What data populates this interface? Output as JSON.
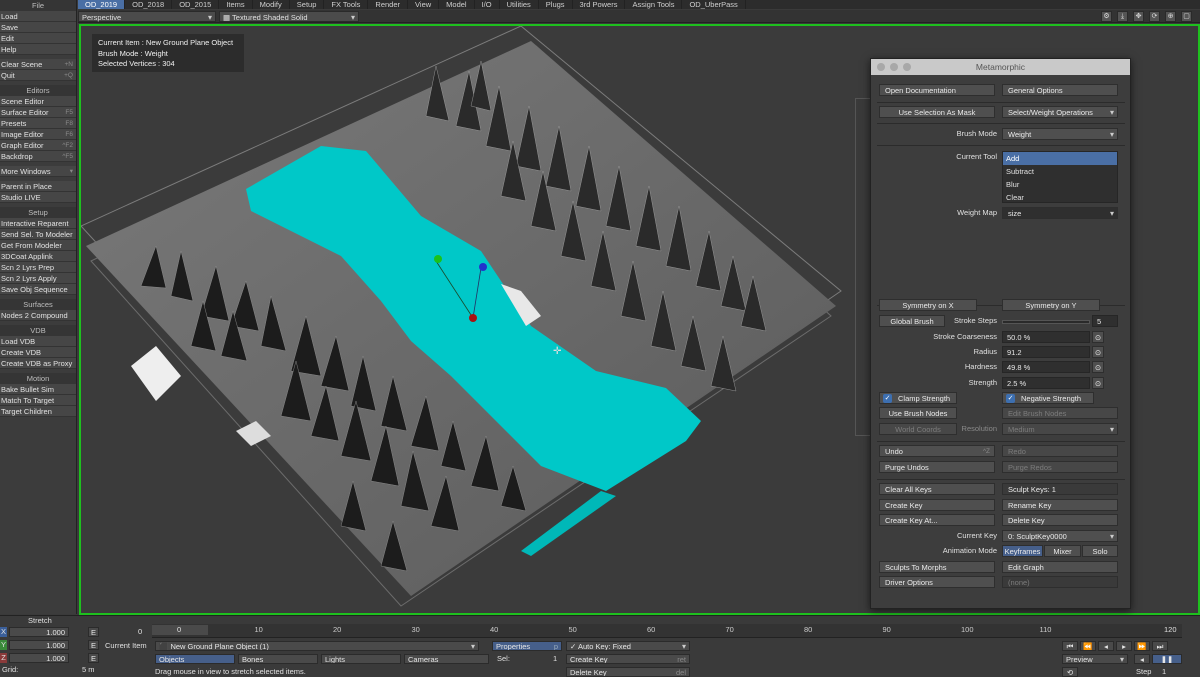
{
  "menubar": [
    "OD_2019",
    "OD_2018",
    "OD_2015",
    "Items",
    "Modify",
    "Setup",
    "FX Tools",
    "Render",
    "View",
    "Model",
    "I/O",
    "Utilities",
    "Plugs",
    "3rd Powers",
    "Assign Tools",
    "OD_UberPass"
  ],
  "sidebar": {
    "file_header": "File",
    "file_items": [
      {
        "label": "Load",
        "key": ""
      },
      {
        "label": "Save",
        "key": ""
      },
      {
        "label": "Edit",
        "key": ""
      },
      {
        "label": "Help",
        "key": ""
      }
    ],
    "clear_scene": {
      "label": "Clear Scene",
      "key": "+N"
    },
    "quit": {
      "label": "Quit",
      "key": "+Q"
    },
    "editors_header": "Editors",
    "editors": [
      {
        "label": "Scene Editor",
        "key": ""
      },
      {
        "label": "Surface Editor",
        "key": "F5"
      },
      {
        "label": "Presets",
        "key": "F8"
      },
      {
        "label": "Image Editor",
        "key": "F6"
      },
      {
        "label": "Graph Editor",
        "key": "^F2"
      },
      {
        "label": "Backdrop",
        "key": "^F5"
      }
    ],
    "more_windows": "More Windows",
    "parent_in_place": "Parent in Place",
    "studio_live": "Studio LIVE",
    "setup_header": "Setup",
    "setup": [
      "Interactive Reparent",
      "Send Sel. To Modeler",
      "Get From Modeler",
      "3DCoat Applink",
      "Scn 2 Lyrs Prep",
      "Scn 2 Lyrs Apply",
      "Save Obj Sequence"
    ],
    "surfaces_header": "Surfaces",
    "surfaces": [
      "Nodes 2 Compound"
    ],
    "vdb_header": "VDB",
    "vdb": [
      "Load VDB",
      "Create VDB",
      "Create VDB as Proxy"
    ],
    "motion_header": "Motion",
    "motion": [
      "Bake Bullet Sim",
      "Match To Target",
      "Target Children"
    ]
  },
  "viewport": {
    "view_mode": "Perspective",
    "shading": "Textured Shaded Solid",
    "info": {
      "line1": "Current Item : New Ground Plane Object",
      "line2": "Brush Mode : Weight",
      "line3": "Selected Vertices : 304"
    }
  },
  "panel": {
    "title": "Metamorphic",
    "open_documentation": "Open Documentation",
    "general_options": "General Options",
    "use_selection_as_mask": "Use Selection As Mask",
    "select_weight_ops": "Select/Weight Operations",
    "brush_mode_label": "Brush Mode",
    "brush_mode_value": "Weight",
    "current_tool_label": "Current Tool",
    "tools": [
      "Add",
      "Subtract",
      "Blur",
      "Clear"
    ],
    "weight_map_label": "Weight Map",
    "weight_map_value": "size",
    "symmetry_x": "Symmetry on X",
    "symmetry_y": "Symmetry on Y",
    "global_brush": "Global Brush",
    "stroke_steps_label": "Stroke Steps",
    "stroke_steps_value": "5",
    "stroke_coarseness_label": "Stroke Coarseness",
    "stroke_coarseness_value": "50.0 %",
    "radius_label": "Radius",
    "radius_value": "91.2",
    "hardness_label": "Hardness",
    "hardness_value": "49.8 %",
    "strength_label": "Strength",
    "strength_value": "2.5 %",
    "clamp_strength": "Clamp Strength",
    "negative_strength": "Negative Strength",
    "use_brush_nodes": "Use Brush Nodes",
    "edit_brush_nodes": "Edit Brush Nodes",
    "world_coords": "World Coords",
    "resolution_label": "Resolution",
    "resolution_value": "Medium",
    "undo": "Undo",
    "undo_key": "^Z",
    "redo": "Redo",
    "purge_undos": "Purge Undos",
    "purge_redos": "Purge Redos",
    "clear_all_keys": "Clear All Keys",
    "sculpt_keys": "Sculpt Keys: 1",
    "create_key": "Create Key",
    "rename_key": "Rename Key",
    "create_key_at": "Create Key At...",
    "delete_key": "Delete Key",
    "current_key_label": "Current Key",
    "current_key_value": "0: SculptKey0000",
    "animation_mode_label": "Animation Mode",
    "animation_modes": [
      "Keyframes",
      "Mixer",
      "Solo"
    ],
    "sculpts_to_morphs": "Sculpts To Morphs",
    "edit_graph": "Edit Graph",
    "driver_options": "Driver Options",
    "none": "(none)"
  },
  "bottom": {
    "stretch_label": "Stretch",
    "x_label": "X",
    "y_label": "Y",
    "z_label": "Z",
    "x_value": "1.000",
    "y_value": "1.000",
    "z_value": "1.000",
    "e_label": "E",
    "grid_label": "Grid:",
    "grid_value": "5 m",
    "frame_start": "0",
    "frame_current": "0",
    "ticks": [
      "10",
      "20",
      "30",
      "40",
      "50",
      "60",
      "70",
      "80",
      "90",
      "100",
      "110"
    ],
    "frame_end": "120",
    "current_item_label": "Current Item",
    "current_item_value": "New Ground Plane Object (1)",
    "properties": "Properties",
    "properties_key": "p",
    "auto_key": "Auto Key: Fixed",
    "objects": "Objects",
    "bones": "Bones",
    "lights": "Lights",
    "cameras": "Cameras",
    "sel_label": "Sel:",
    "sel_value": "1",
    "create_key": "Create Key",
    "create_key_shortcut": "ret",
    "delete_key": "Delete Key",
    "delete_key_shortcut": "del",
    "status": "Drag mouse in view to stretch selected items.",
    "preview": "Preview",
    "step_label": "Step",
    "step_value": "1"
  }
}
